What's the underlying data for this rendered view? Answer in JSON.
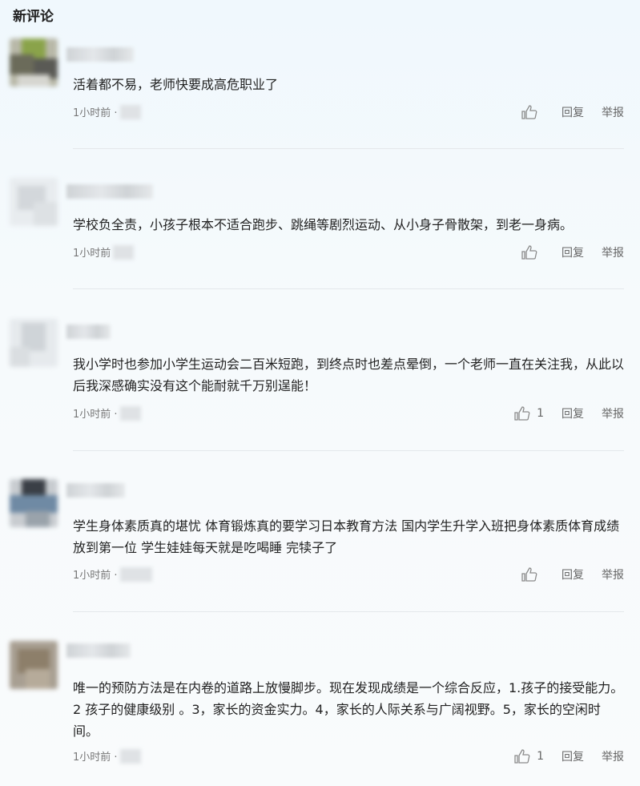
{
  "section_title": "新评论",
  "actions": {
    "reply": "回复",
    "report": "举报"
  },
  "comments": [
    {
      "text": "活着都不易，老师快要成高危职业了",
      "time": "1小时前 ·",
      "likes": ""
    },
    {
      "text": "学校负全责，小孩子根本不适合跑步、跳绳等剧烈运动、从小身子骨散架，到老一身病。",
      "time": "1小时前",
      "likes": ""
    },
    {
      "text": "我小学时也参加小学生运动会二百米短跑，到终点时也差点晕倒，一个老师一直在关注我，从此以后我深感确实没有这个能耐就千万别逞能！",
      "time": "1小时前 ·",
      "likes": "1"
    },
    {
      "text": "学生身体素质真的堪忧 体育锻炼真的要学习日本教育方法 国内学生升学入班把身体素质体育成绩放到第一位 学生娃娃每天就是吃喝睡 完犊子了",
      "time": "1小时前 ·",
      "likes": ""
    },
    {
      "text": "唯一的预防方法是在内卷的道路上放慢脚步。现在发现成绩是一个综合反应，1.孩子的接受能力。2 孩子的健康级别 。3，家长的资金实力。4，家长的人际关系与广阔视野。5，家长的空闲时间。",
      "time": "1小时前 ·",
      "likes": "1"
    }
  ]
}
